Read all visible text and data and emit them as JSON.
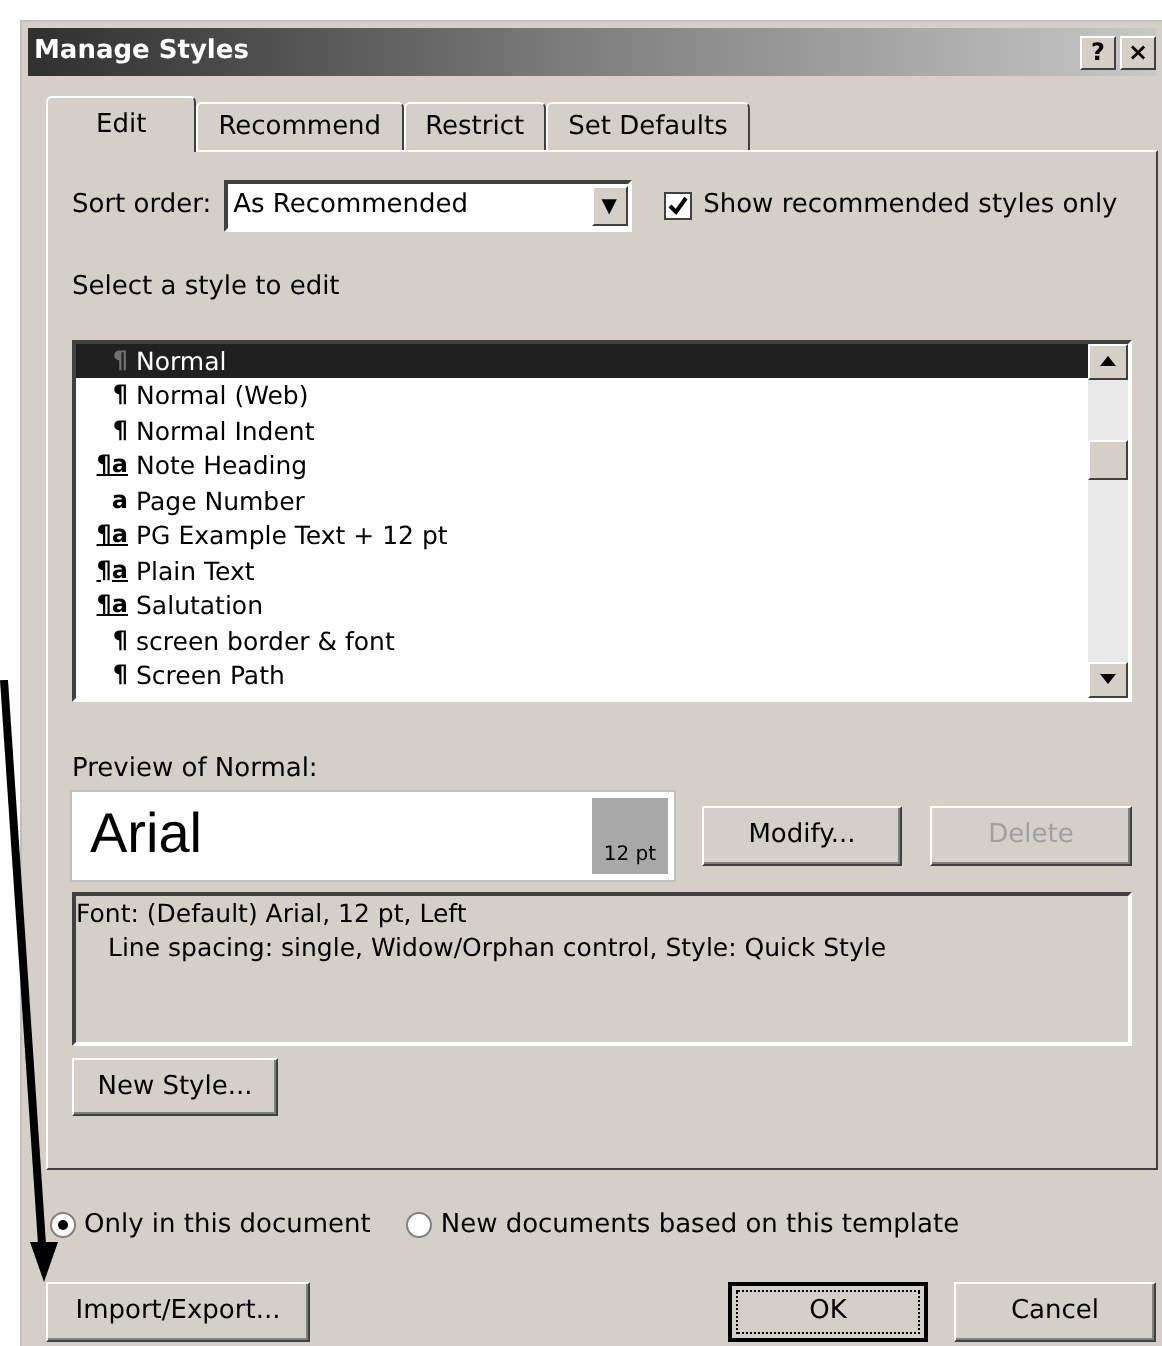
{
  "window": {
    "title": "Manage Styles",
    "buttons": [
      "?",
      "×"
    ]
  },
  "tabs": [
    {
      "label": "Edit",
      "selected": true
    },
    {
      "label": "Recommend",
      "selected": false
    },
    {
      "label": "Restrict",
      "selected": false
    },
    {
      "label": "Set Defaults",
      "selected": false
    }
  ],
  "sort_order": {
    "label": "Sort order:",
    "value": "As Recommended",
    "dropdown_glyph": "▼"
  },
  "show_recommended": {
    "label": "Show recommended styles only",
    "checked": true
  },
  "list_label": "Select a style to edit",
  "styles": [
    {
      "name": "Normal",
      "kind": "paragraph",
      "glyph": "¶",
      "selected": true
    },
    {
      "name": "Normal (Web)",
      "kind": "paragraph",
      "glyph": "¶",
      "selected": false
    },
    {
      "name": "Normal Indent",
      "kind": "paragraph",
      "glyph": "¶",
      "selected": false
    },
    {
      "name": "Note Heading",
      "kind": "linked",
      "glyph": "¶a",
      "selected": false
    },
    {
      "name": "Page Number",
      "kind": "character",
      "glyph": "a",
      "selected": false
    },
    {
      "name": "PG Example Text + 12 pt",
      "kind": "linked",
      "glyph": "¶a",
      "selected": false
    },
    {
      "name": "Plain Text",
      "kind": "linked",
      "glyph": "¶a",
      "selected": false
    },
    {
      "name": "Salutation",
      "kind": "linked",
      "glyph": "¶a",
      "selected": false
    },
    {
      "name": "screen border & font",
      "kind": "paragraph",
      "glyph": "¶",
      "selected": false
    },
    {
      "name": "Screen Path",
      "kind": "paragraph",
      "glyph": "¶",
      "selected": false
    }
  ],
  "preview": {
    "label": "Preview of Normal:",
    "sample": "Arial",
    "size": "12 pt"
  },
  "modify_button": {
    "label": "Modify...",
    "disabled": false
  },
  "delete_button": {
    "label": "Delete",
    "disabled": true
  },
  "description": [
    "Font: (Default) Arial, 12 pt, Left",
    "Line spacing:  single, Widow/Orphan control, Style: Quick Style"
  ],
  "new_style_button": "New Style...",
  "scope": [
    {
      "label": "Only in this document",
      "selected": true
    },
    {
      "label": "New documents based on this template",
      "selected": false
    }
  ],
  "buttons": {
    "import_export": "Import/Export...",
    "ok": "OK",
    "cancel": "Cancel"
  }
}
